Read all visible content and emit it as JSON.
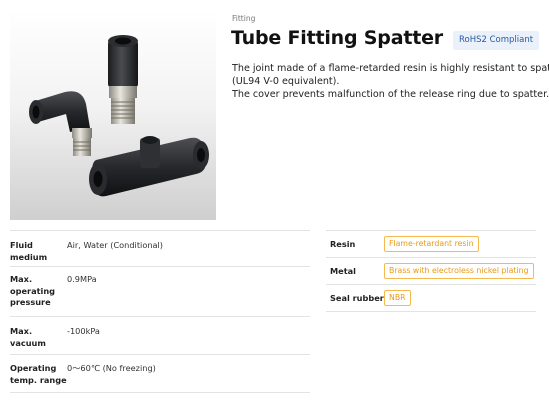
{
  "header": {
    "category": "Fitting",
    "title": "Tube Fitting Spatter",
    "rohs_badge": "RoHS2 Compliant"
  },
  "image": {
    "icon": "product-photo-fittings"
  },
  "description": [
    "The joint made of a flame-retarded resin is highly resistant to spatters",
    "(UL94 V-0 equivalent).",
    "The cover prevents malfunction of the release ring due to spatter."
  ],
  "specs": [
    {
      "label": "Fluid medium",
      "value": "Air, Water (Conditional)"
    },
    {
      "label": "Max. operating pressure",
      "value": "0.9MPa"
    },
    {
      "label": "Max. vacuum",
      "value": "-100kPa"
    },
    {
      "label": "Operating temp. range",
      "value": "0〜60℃ (No freezing)"
    }
  ],
  "materials": [
    {
      "label": "Resin",
      "value": "Flame-retardant resin"
    },
    {
      "label": "Metal",
      "value": "Brass with electroless nickel plating"
    },
    {
      "label": "Seal rubber",
      "value": "NBR"
    }
  ],
  "colors": {
    "badge_bg": "#eaf1fb",
    "badge_text": "#2a5aa0",
    "tag_border": "#f5b94d",
    "tag_text": "#e79a17",
    "divider": "#e3e3e3"
  }
}
